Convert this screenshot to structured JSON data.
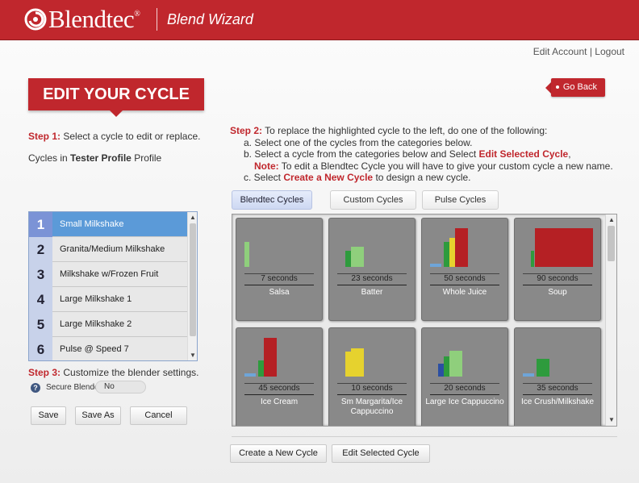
{
  "header": {
    "brand": "Blendtec",
    "brand_mark": "®",
    "app_title": "Blend Wizard"
  },
  "account": {
    "edit_account": "Edit Account",
    "separator": "|",
    "logout": "Logout"
  },
  "banner": {
    "title": "EDIT YOUR CYCLE"
  },
  "go_back": {
    "label": "Go Back"
  },
  "step1": {
    "label": "Step 1:",
    "text": "Select a cycle to edit or replace.",
    "profile_prefix": "Cycles in",
    "profile_name": "Tester Profile",
    "profile_suffix": "Profile"
  },
  "step2": {
    "label": "Step 2:",
    "text": "To replace the highlighted cycle to the left, do one of the following:",
    "a": "a. Select one of the cycles from the categories below.",
    "b_prefix": "b. Select a cycle from the categories below and Select",
    "b_link": "Edit Selected Cycle",
    "b_suffix": ",",
    "note_label": "Note:",
    "note_text": "To edit a Blendtec Cycle you will have to give your custom cycle a new name.",
    "c_prefix": "c. Select",
    "c_link": "Create a New Cycle",
    "c_suffix": "to design a new cycle."
  },
  "cycle_list": {
    "items": [
      {
        "number": "1",
        "name": "Small Milkshake",
        "selected": true
      },
      {
        "number": "2",
        "name": "Granita/Medium Milkshake",
        "selected": false
      },
      {
        "number": "3",
        "name": "Milkshake w/Frozen Fruit",
        "selected": false
      },
      {
        "number": "4",
        "name": "Large Milkshake 1",
        "selected": false
      },
      {
        "number": "5",
        "name": "Large Milkshake 2",
        "selected": false
      },
      {
        "number": "6",
        "name": "Pulse @ Speed 7",
        "selected": false
      }
    ]
  },
  "step3": {
    "label": "Step 3:",
    "text": "Customize the blender settings.",
    "help_icon_text": "?",
    "secure_label": "Secure Blender",
    "secure_value": "No"
  },
  "buttons": {
    "save": "Save",
    "save_as": "Save As",
    "cancel": "Cancel",
    "create_new": "Create a New Cycle",
    "edit_selected": "Edit Selected Cycle"
  },
  "tabs": [
    {
      "label": "Blendtec Cycles",
      "active": true
    },
    {
      "label": "Custom Cycles",
      "active": false
    },
    {
      "label": "Pulse Cycles",
      "active": false
    }
  ],
  "colors": {
    "brand_red": "#c0272d",
    "bar_green": "#2e9b3d",
    "bar_lightgreen": "#8fcf7c",
    "bar_yellow": "#e6d22e",
    "bar_red": "#b52024",
    "bar_blue": "#2b4fa3",
    "bar_lightblue": "#6ea5d9"
  },
  "cycle_cards": [
    {
      "seconds": "7 seconds",
      "name": "Salsa",
      "bars": [
        {
          "color": "bar_lightgreen",
          "level": 0.55
        }
      ]
    },
    {
      "seconds": "23 seconds",
      "name": "Batter",
      "bars": [
        {
          "color": "bar_green",
          "level": 0.35
        },
        {
          "color": "bar_lightgreen",
          "level": 0.45
        }
      ]
    },
    {
      "seconds": "50 seconds",
      "name": "Whole Juice",
      "bars": [
        {
          "color": "bar_lightblue",
          "level": 0.08
        },
        {
          "color": "bar_green",
          "level": 0.55
        },
        {
          "color": "bar_yellow",
          "level": 0.64
        },
        {
          "color": "bar_red",
          "level": 0.85
        }
      ]
    },
    {
      "seconds": "90 seconds",
      "name": "Soup",
      "bars": [
        {
          "color": "bar_green",
          "level": 0.35
        },
        {
          "color": "bar_red",
          "level": 0.85
        }
      ]
    },
    {
      "seconds": "45 seconds",
      "name": "Ice Cream",
      "bars": [
        {
          "color": "bar_lightblue",
          "level": 0.08
        },
        {
          "color": "bar_green",
          "level": 0.35
        },
        {
          "color": "bar_red",
          "level": 0.85
        }
      ]
    },
    {
      "seconds": "10 seconds",
      "name": "Sm Margarita/Ice Cappuccino",
      "bars": [
        {
          "color": "bar_yellow",
          "level": 0.55
        },
        {
          "color": "bar_yellow",
          "level": 0.62
        }
      ]
    },
    {
      "seconds": "20 seconds",
      "name": "Large Ice Cappuccino",
      "bars": [
        {
          "color": "bar_blue",
          "level": 0.28
        },
        {
          "color": "bar_green",
          "level": 0.45
        },
        {
          "color": "bar_lightgreen",
          "level": 0.57
        }
      ]
    },
    {
      "seconds": "35 seconds",
      "name": "Ice Crush/Milkshake",
      "bars": [
        {
          "color": "bar_lightblue",
          "level": 0.08
        },
        {
          "color": "bar_green",
          "level": 0.4
        }
      ]
    }
  ]
}
